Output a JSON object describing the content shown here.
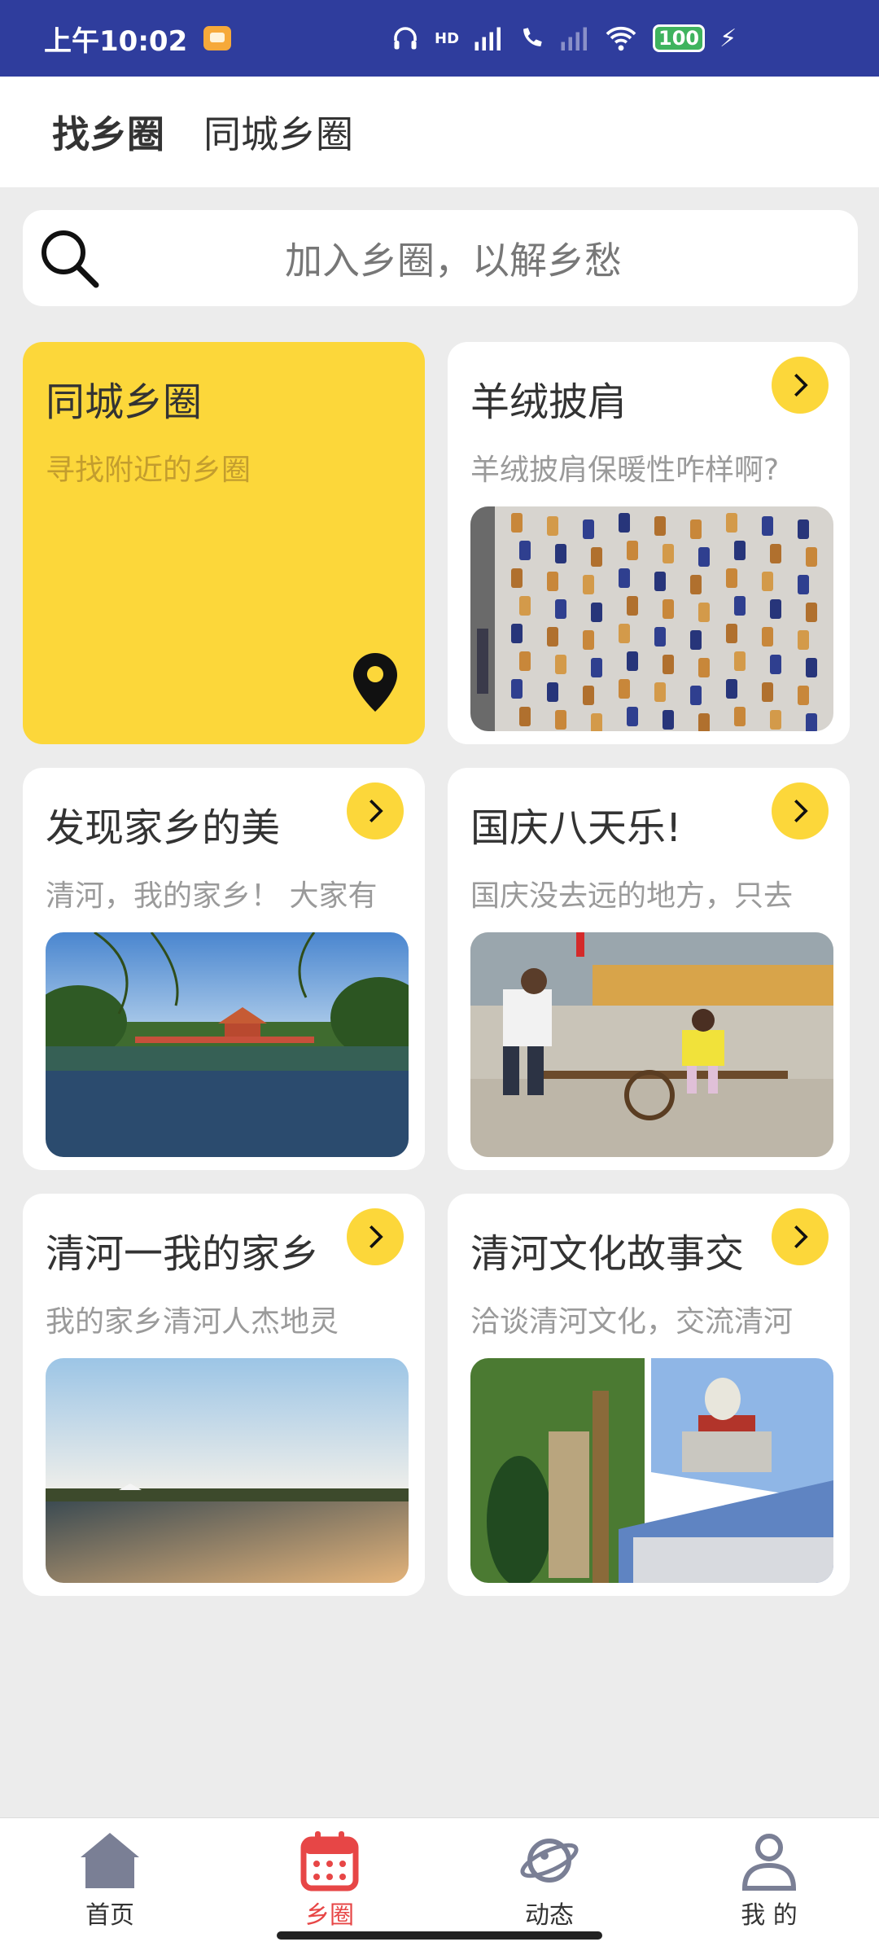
{
  "status_bar": {
    "time": "上午10:02",
    "network_label": "HD",
    "battery": "100"
  },
  "top_tabs": [
    {
      "label": "找乡圈",
      "active": true
    },
    {
      "label": "同城乡圈",
      "active": false
    }
  ],
  "search": {
    "placeholder": "加入乡圈，以解乡愁"
  },
  "cards": [
    {
      "title": "同城乡圈",
      "desc": "寻找附近的乡圈",
      "icon": "location-pin-icon"
    },
    {
      "title": "羊绒披肩",
      "desc": "羊绒披肩保暖性咋样啊?",
      "image": "yarn-spools-wall"
    },
    {
      "title": "发现家乡的美",
      "desc": "清河，我的家乡！ 大家有",
      "image": "pavilion-lake"
    },
    {
      "title": "国庆八天乐!",
      "desc": "国庆没去远的地方，只去",
      "image": "family-cart"
    },
    {
      "title": "清河一我的家乡",
      "desc": "我的家乡清河人杰地灵",
      "image": "sunset-lake"
    },
    {
      "title": "清河文化故事交",
      "desc": "洽谈清河文化，交流清河",
      "image": "culture-collage"
    }
  ],
  "bottom_nav": [
    {
      "label": "首页",
      "icon": "home-icon",
      "active": false
    },
    {
      "label": "乡圈",
      "icon": "calendar-icon",
      "active": true
    },
    {
      "label": "动态",
      "icon": "planet-icon",
      "active": false
    },
    {
      "label": "我 的",
      "icon": "profile-icon",
      "active": false
    }
  ],
  "colors": {
    "status_bar": "#2f3d9d",
    "accent_yellow": "#fcd73a",
    "active_nav": "#e74646"
  }
}
